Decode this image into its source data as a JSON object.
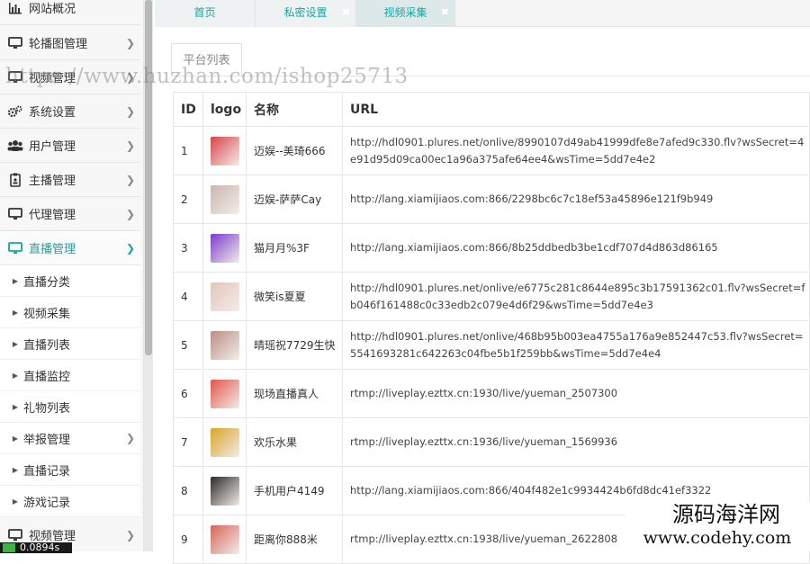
{
  "sidebar": {
    "menu": [
      {
        "label": "网站概况",
        "icon": "bar-chart-icon"
      },
      {
        "label": "轮播图管理",
        "icon": "monitor-icon"
      },
      {
        "label": "视频管理",
        "icon": "monitor-icon"
      },
      {
        "label": "系统设置",
        "icon": "gears-icon"
      },
      {
        "label": "用户管理",
        "icon": "users-icon"
      },
      {
        "label": "主播管理",
        "icon": "badge-icon"
      },
      {
        "label": "代理管理",
        "icon": "monitor-icon"
      },
      {
        "label": "直播管理",
        "icon": "monitor-icon"
      }
    ],
    "submenu": [
      {
        "label": "直播分类"
      },
      {
        "label": "视频采集"
      },
      {
        "label": "直播列表"
      },
      {
        "label": "直播监控"
      },
      {
        "label": "礼物列表"
      },
      {
        "label": "举报管理"
      },
      {
        "label": "直播记录"
      },
      {
        "label": "游戏记录"
      }
    ],
    "bottom_item": {
      "label": "视频管理"
    },
    "badge": "0.0894s"
  },
  "tabs": [
    {
      "label": "首页"
    },
    {
      "label": "私密设置"
    },
    {
      "label": "视频采集"
    }
  ],
  "subtab": "平台列表",
  "table": {
    "headers": [
      "ID",
      "logo",
      "名称",
      "URL"
    ],
    "rows": [
      {
        "id": "1",
        "name": "迈娱--美琦666",
        "url": "http://hdl0901.plures.net/onlive/8990107d49ab41999dfe8e7afed9c330.flv?wsSecret=4e91d95d09ca00ec1a96a375afe64ee4&wsTime=5dd7e4e2",
        "logo_color": "#d9434a"
      },
      {
        "id": "2",
        "name": "迈娱-萨萨Cay",
        "url": "http://lang.xiamijiaos.com:866/2298bc6c7c18ef53a45896e121f9b949",
        "logo_color": "#c9b7ae"
      },
      {
        "id": "3",
        "name": "猫月月%3F",
        "url": "http://lang.xiamijiaos.com:866/8b25ddbedb3be1cdf707d4d863d86165",
        "logo_color": "#7a3bd0"
      },
      {
        "id": "4",
        "name": "微笑is夏夏",
        "url": "http://hdl0901.plures.net/onlive/e6775c281c8644e895c3b17591362c01.flv?wsSecret=fb046f161488c0c33edb2c079e4d6f29&wsTime=5dd7e4e3",
        "logo_color": "#e3c6bd"
      },
      {
        "id": "5",
        "name": "晴瑶祝7729生快",
        "url": "http://hdl0901.plures.net/onlive/468b95b003ea4755a176a9e852447c53.flv?wsSecret=5541693281c642263c04fbe5b1f259bb&wsTime=5dd7e4e4",
        "logo_color": "#b88f86"
      },
      {
        "id": "6",
        "name": "现场直播真人",
        "url": "rtmp://liveplay.ezttx.cn:1930/live/yueman_2507300",
        "logo_color": "#e2554a"
      },
      {
        "id": "7",
        "name": "欢乐水果",
        "url": "rtmp://liveplay.ezttx.cn:1936/live/yueman_1569936",
        "logo_color": "#d8a524"
      },
      {
        "id": "8",
        "name": "手机用户4149",
        "url": "http://lang.xiamijiaos.com:866/404f482e1c9934424b6fd8dc41ef3322",
        "logo_color": "#2b2b2b"
      },
      {
        "id": "9",
        "name": "距离你888米",
        "url": "rtmp://liveplay.ezttx.cn:1938/live/yueman_2622808",
        "logo_color": "#d6655a"
      }
    ]
  },
  "watermark": "https://www.huzhan.com/ishop25713",
  "footer_mark": {
    "cn": "源码海洋网",
    "url": "www.codehy.com"
  },
  "colors": {
    "accent": "#11a7a2"
  }
}
